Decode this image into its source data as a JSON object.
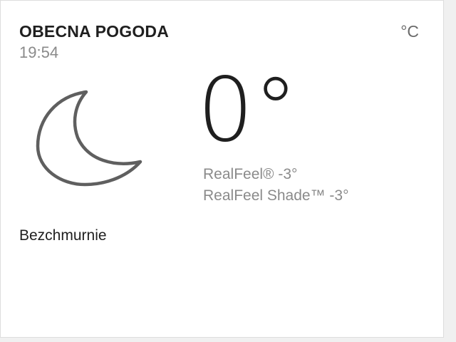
{
  "header": {
    "title": "OBECNA POGODA",
    "time": "19:54",
    "unit": "°C"
  },
  "current": {
    "icon": "moon-icon",
    "temperature": "0°",
    "realfeel": "RealFeel® -3°",
    "realfeel_shade": "RealFeel Shade™ -3°",
    "condition": "Bezchmurnie"
  },
  "colors": {
    "primary_text": "#1f1f1f",
    "secondary_text": "#8a8a8a",
    "icon_stroke": "#5f5f5f"
  }
}
